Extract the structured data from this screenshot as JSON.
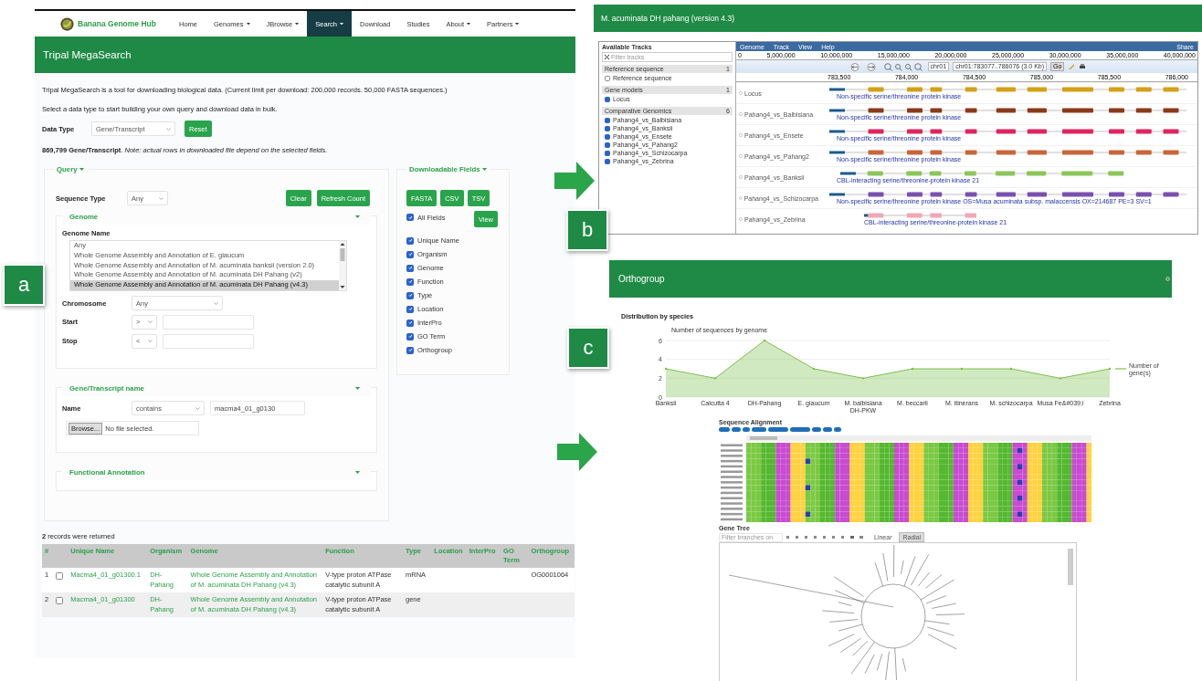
{
  "figure_labels": [
    "a",
    "b",
    "c"
  ],
  "panel_a": {
    "site": {
      "logo_text": "Banana Genome Hub",
      "nav": [
        {
          "label": "Home",
          "has_menu": false,
          "selected": false
        },
        {
          "label": "Genomes",
          "has_menu": true,
          "selected": false
        },
        {
          "label": "JBrowse",
          "has_menu": true,
          "selected": false
        },
        {
          "label": "Search",
          "has_menu": true,
          "selected": true
        },
        {
          "label": "Download",
          "has_menu": false,
          "selected": false
        },
        {
          "label": "Studies",
          "has_menu": false,
          "selected": false
        },
        {
          "label": "About",
          "has_menu": true,
          "selected": false
        },
        {
          "label": "Partners",
          "has_menu": true,
          "selected": false
        }
      ]
    },
    "page_title": "Tripal MegaSearch",
    "intro": "Tripal MegaSearch is a tool for downloading biological data. (Current limit per download: 200,000 records. 50,000 FASTA sequences.)",
    "instruction": "Select a data type to start building your own query and download data in bulk.",
    "data_type": {
      "label": "Data Type",
      "value": "Gene/Transcript",
      "button": "Reset"
    },
    "count_note": "**869,799 Gene/Transcript**. *Note: actual rows in downloaded file depend on the selected fields.*",
    "query": {
      "title": "Query",
      "sequence_type": {
        "label": "Sequence Type",
        "value": "Any"
      },
      "buttons": [
        "Clear",
        "Refresh Count"
      ],
      "genome": {
        "title": "Genome",
        "name_label": "Genome Name",
        "options": [
          {
            "label": "Any",
            "selected": false
          },
          {
            "label": "Whole Genome Assembly and Annotation of E. glaucum",
            "selected": false
          },
          {
            "label": "Whole Genome Assembly and Annotation of M. acuminata banksii (version 2.0)",
            "selected": false
          },
          {
            "label": "Whole Genome Assembly and Annotation of M. acuminata DH Pahang (v2)",
            "selected": false
          },
          {
            "label": "Whole Genome Assembly and Annotation of M. acuminata DH Pahang (v4.3)",
            "selected": true
          }
        ],
        "chromosome": {
          "label": "Chromosome",
          "value": "Any"
        },
        "start": {
          "label": "Start",
          "operator": ">"
        },
        "stop": {
          "label": "Stop",
          "operator": "<"
        }
      },
      "gene_name": {
        "title": "Gene/Transcript name",
        "name_label": "Name",
        "operator": "contains",
        "value": "macma4_01_g0130",
        "browse_button": "Browse...",
        "file_status": "No file selected."
      },
      "functional_annotation": {
        "title": "Functional Annotation"
      }
    },
    "downloadable": {
      "title": "Downloadable Fields",
      "formats": [
        "FASTA",
        "CSV",
        "TSV"
      ],
      "view_button": "View",
      "fields": [
        {
          "label": "All Fields",
          "checked": true
        },
        {
          "label": "Unique Name",
          "checked": true
        },
        {
          "label": "Organism",
          "checked": true
        },
        {
          "label": "Genome",
          "checked": true
        },
        {
          "label": "Function",
          "checked": true
        },
        {
          "label": "Type",
          "checked": true
        },
        {
          "label": "Location",
          "checked": true
        },
        {
          "label": "InterPro",
          "checked": true
        },
        {
          "label": "GO Term",
          "checked": true
        },
        {
          "label": "Orthogroup",
          "checked": true
        }
      ]
    },
    "results": {
      "summary": "**2** records were returned",
      "columns": [
        {
          "label": "#",
          "kind": "index"
        },
        {
          "kind": "select"
        },
        {
          "label": "Unique Name",
          "kind": "link"
        },
        {
          "label": "Organism",
          "kind": "link"
        },
        {
          "label": "Genome",
          "kind": "link"
        },
        {
          "label": "Function",
          "kind": "text"
        },
        {
          "label": "Type",
          "kind": "text"
        },
        {
          "label": "Location",
          "kind": "text"
        },
        {
          "label": "InterPro",
          "kind": "text"
        },
        {
          "label": "GO Term",
          "kind": "text"
        },
        {
          "label": "Orthogroup",
          "kind": "text"
        }
      ],
      "rows": [
        {
          "checked": false,
          "cells": [
            "1",
            "",
            "Macma4_01_g01300.1",
            "DH-Pahang",
            "Whole Genome Assembly and Annotation of M. acuminata DH Pahang (v4.3)",
            "V-type proton ATPase catalytic subunit A",
            "mRNA",
            "",
            "",
            "",
            "OG0001064"
          ]
        },
        {
          "checked": false,
          "cells": [
            "2",
            "",
            "Macma4_01_g01300",
            "DH-Pahang",
            "Whole Genome Assembly and Annotation of M. acuminata DH Pahang (v4.3)",
            "V-type proton ATPase catalytic subunit A",
            "gene",
            "",
            "",
            "",
            ""
          ]
        }
      ]
    }
  },
  "panel_b": {
    "title": "M. acuminata DH pahang (version 4.3)",
    "sidebar": {
      "title": "Available Tracks",
      "filter_placeholder": "Filter tracks",
      "sections": [
        {
          "label": "Reference sequence",
          "count": "1",
          "tracks": [
            {
              "label": "Reference sequence",
              "checked": false
            }
          ]
        },
        {
          "label": "Gene models",
          "count": "1",
          "tracks": [
            {
              "label": "Locus",
              "checked": true
            }
          ]
        },
        {
          "label": "Comparative Genomics",
          "count": "6",
          "tracks": [
            {
              "label": "Pahang4_vs_Balbisiana",
              "checked": true
            },
            {
              "label": "Pahang4_vs_Banksii",
              "checked": true
            },
            {
              "label": "Pahang4_vs_Ensete",
              "checked": true
            },
            {
              "label": "Pahang4_vs_Pahang2",
              "checked": true
            },
            {
              "label": "Pahang4_vs_Schizocarpa",
              "checked": true
            },
            {
              "label": "Pahang4_vs_Zebrina",
              "checked": true
            }
          ]
        }
      ]
    },
    "menu": [
      "Genome",
      "Track",
      "View",
      "Help"
    ],
    "share": "Share",
    "overview_ticks": [
      "0",
      "5,000,000",
      "10,000,000",
      "15,000,000",
      "20,000,000",
      "25,000,000",
      "30,000,000",
      "35,000,000",
      "40,000,000"
    ],
    "chromosome": "chr01",
    "location": "chr01:783077..786076 (3.0 Kb)",
    "go_button": "Go",
    "detail_ticks": [
      "783,500",
      "784,000",
      "784,500",
      "785,000",
      "785,500",
      "786,000"
    ],
    "tracks": [
      {
        "label": "Locus",
        "color": "#d4a017",
        "description": "Non-specific serine/threonine protein kinase"
      },
      {
        "label": "Pahang4_vs_Balbisiana",
        "color": "#8b3a1a",
        "description": "Non-specific serine/threonine protein kinase"
      },
      {
        "label": "Pahang4_vs_Ensete",
        "color": "#e0245e",
        "description": "Non-specific serine/threonine protein kinase"
      },
      {
        "label": "Pahang4_vs_Pahang2",
        "color": "#c8663a",
        "description": "Non-specific serine/threonine protein kinase"
      },
      {
        "label": "Pahang4_vs_Banksii",
        "color": "#8cc65a",
        "description": "CBL-interacting serine/threonine-protein kinase 21"
      },
      {
        "label": "Pahang4_vs_Schizocarpa",
        "color": "#7b4fb0",
        "description": "Non-specific serine/threonine protein kinase OS=Musa acuminata subsp. malaccensis OX=214687 PE=3 SV=1"
      },
      {
        "label": "Pahang4_vs_Zebrina",
        "color": "#f0a8b8",
        "description": "CBL-interacting serine/threonine-protein kinase 21"
      }
    ]
  },
  "panel_c": {
    "title": "Orthogroup",
    "distribution_title": "Distribution by species",
    "chart_data": {
      "type": "area",
      "title": "Number of sequences by genome",
      "categories": [
        "Banksii",
        "Calcutta 4",
        "DH-Pahang",
        "E. glaucum",
        "M. balbisiana DH-PKW",
        "M. beccarii",
        "M. itinerans",
        "M. schizocarpa",
        "Musa Fe&#039;i",
        "Zebrina"
      ],
      "series": [
        {
          "name": "Number of gene(s)",
          "color": "#7cc04b",
          "values": [
            3,
            2,
            6,
            3,
            2,
            3,
            3,
            3,
            2,
            3
          ]
        }
      ],
      "ylim": [
        0,
        6
      ],
      "yticks": [
        0,
        2,
        4,
        6
      ]
    },
    "alignment_title": "Sequence Alignment",
    "tree_title": "Gene Tree",
    "tree_filter_placeholder": "Filter branches on",
    "layouts": [
      {
        "label": "Linear",
        "selected": false
      },
      {
        "label": "Radial",
        "selected": true
      }
    ]
  }
}
